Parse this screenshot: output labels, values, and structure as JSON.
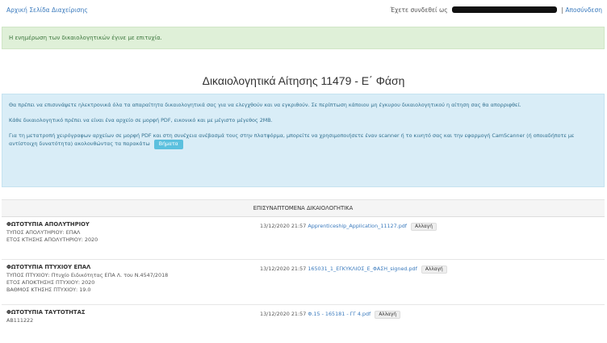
{
  "header": {
    "breadcrumb": "Αρχική Σελίδα Διαχείρισης",
    "logged_in_as": "Έχετε συνδεθεί ως",
    "logout": "Αποσύνδεση"
  },
  "alert_success": "Η ενημέρωση των δικαιολογητικών έγινε με επιτυχία.",
  "page_title": "Δικαιολογητικά Αίτησης 11479 - Ε΄ Φάση",
  "info": {
    "p1": "Θα πρέπει να επισυνάψετε ηλεκτρονικά όλα τα απαραίτητα δικαιολογητικά σας για να ελεγχθούν και να εγκριθούν. Σε περίπτωση κάποιου μη έγκυρου δικαιολογητικού η αίτηση σας θα απορριφθεί.",
    "p2": "Κάθε δικαιολογητικό πρέπει να είναι ένα αρχείο σε μορφή PDF, εικονικό και με μέγιστο μέγεθος 2MB.",
    "p3": "Για τη μετατροπή χειρόγραφων αρχείων σε μορφή PDF και στη συνέχεια ανέβασμά τους στην πλατφόρμα, μπορείτε να χρησιμοποιήσετε έναν scanner ή το κινητό σας και την εφαρμογή CamScanner (ή οποιαδήποτε με αντίστοιχη δυνατότητα) ακολουθώντας τα παρακάτω",
    "button": "Βήματα"
  },
  "table": {
    "header": "ΕΠΙΣΥΝΑΠΤΟΜΕΝΑ ΔΙΚΑΙΟΛΟΓΗΤΙΚΑ",
    "change_label": "Αλλαγή",
    "rows": [
      {
        "title": "ΦΩΤΟΤΥΠΙΑ ΑΠΟΛΥΤΗΡΙΟΥ",
        "lines": [
          "ΤΥΠΟΣ ΑΠΟΛΥΤΗΡΙΟΥ: ΕΠΑΛ",
          "ΕΤΟΣ ΚΤΗΣΗΣ ΑΠΟΛΥΤΗΡΙΟΥ: 2020"
        ],
        "timestamp": "13/12/2020 21:57",
        "file": "Apprenticeship_Application_11127.pdf"
      },
      {
        "title": "ΦΩΤΟΤΥΠΙΑ ΠΤΥΧΙΟΥ ΕΠΑΛ",
        "lines": [
          "ΤΥΠΟΣ ΠΤΥΧΙΟΥ: Πτυχίο Ειδικότητας ΕΠΑ Λ. του Ν.4547/2018",
          "ΕΤΟΣ ΑΠΟΚΤΗΣΗΣ ΠΤΥΧΙΟΥ: 2020",
          "ΒΑΘΜΟΣ ΚΤΗΣΗΣ ΠΤΥΧΙΟΥ: 19.0"
        ],
        "timestamp": "13/12/2020 21:57",
        "file": "165031_1_ΕΓΚΥΚΛΙΟΣ_Ε_ΦΑΣΗ_signed.pdf"
      },
      {
        "title": "ΦΩΤΟΤΥΠΙΑ ΤΑΥΤΟΤΗΤΑΣ",
        "lines": [
          "AB111222"
        ],
        "timestamp": "13/12/2020 21:57",
        "file": "Φ.15 - 165181 - ΓΓ 4.pdf"
      }
    ]
  }
}
